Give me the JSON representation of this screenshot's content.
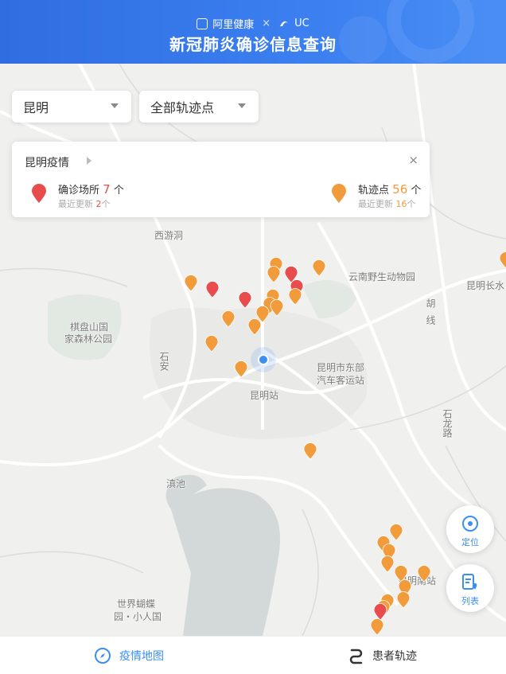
{
  "header": {
    "brand_left": "阿里健康",
    "brand_separator": "×",
    "brand_right": "UC",
    "title": "新冠肺炎确诊信息查询"
  },
  "filters": {
    "city": "昆明",
    "track_type": "全部轨迹点"
  },
  "info_card": {
    "title": "昆明疫情",
    "close": "×",
    "confirmed": {
      "label": "确诊场所",
      "count": "7",
      "unit": "个",
      "recent_label": "最近更新",
      "recent_count": "2",
      "recent_unit": "个"
    },
    "tracks": {
      "label": "轨迹点",
      "count": "56",
      "unit": "个",
      "recent_label": "最近更新",
      "recent_count": "16",
      "recent_unit": "个"
    }
  },
  "map_labels": {
    "xiyoudong": "西游洞",
    "zoo": "云南野生动物园",
    "changshui": "昆明长水",
    "qipanshan_1": "棋盘山国",
    "qipanshan_2": "家森林公园",
    "shi_an": "石安",
    "hu": "胡",
    "xian": "线",
    "dongbu_1": "昆明市东部",
    "dongbu_2": "汽车客运站",
    "station": "昆明站",
    "shilong": "石龙路",
    "dianchi": "滇池",
    "butterfly_1": "世界蝴蝶",
    "butterfly_2": "园・小人国",
    "south_station": "昆明南站"
  },
  "colors": {
    "accent": "#3b8ff0",
    "confirmed_pin": "#e94c4c",
    "track_pin": "#f29b3a",
    "header_blue": "#2f6ee0"
  },
  "fabs": {
    "locate": "定位",
    "list": "列表"
  },
  "bottom_nav": {
    "map": "疫情地图",
    "track": "患者轨迹"
  }
}
